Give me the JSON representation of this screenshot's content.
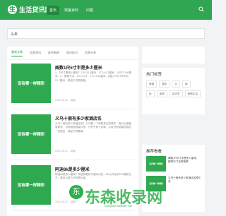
{
  "site": {
    "name": "生活贷讯网",
    "logo_glyph": "生"
  },
  "nav": {
    "items": [
      "首页",
      "常备百科",
      "问答"
    ]
  },
  "breadcrumb": {
    "text": "头条"
  },
  "tabs": [
    "最新文章",
    "信息资讯",
    "综合新闻",
    "知识技巧",
    "信息分享"
  ],
  "posts": [
    {
      "thumb_text": "没有哪一样精彩",
      "title": "阐数1尺5寸半是多少厘米",
      "excerpt": "1、尺5寸是多少厘米？1尺=33.3厘米，5寸=16.7厘米，1尺5寸≈50厘米。2、换算方法：1尺=10寸，1寸=3.33厘米，因此1尺5寸半约为51.7厘米，常用于衣物测量。",
      "meta": [
        "2022-06-21",
        "阅读"
      ]
    },
    {
      "thumb_text": "没有哪一样精彩",
      "title": "义乌十宿有多少家酒店名",
      "excerpt": "义乌十宿有多少家酒店名？义乌是一个商贸发达的城市，吸引大量客商前来，当地酒店数量众多，分布于各个区域，从经济型到高档酒店一应俱全，满足不同需求。",
      "meta": [
        "2022-06-21",
        "阅读"
      ]
    },
    {
      "thumb_text": "没有哪一样精彩",
      "title": "阿迪8k是多少厘米",
      "excerpt": "阿迪8k是多少厘米？阿迪的鞋码与厘米对应，8k大约对应25.5厘米左右，具体以官方尺码表为准。",
      "meta": [
        "2022-06-21",
        "阅读"
      ]
    }
  ],
  "sidebar": {
    "hot_tags_title": "热门标签",
    "tags": [
      "美国",
      "童年",
      "白",
      "城",
      "佳",
      "英语",
      "技巧学",
      "食物生活"
    ],
    "rec_title": "推荐看看",
    "recs": [
      {
        "thumb_text": "没有哪一样精彩",
        "title": "阐数1尺5寸半是多少厘米，脚掌尺寸怎样换算"
      },
      {
        "thumb_text": "没有哪一样精彩",
        "title": "义乌十宿有多少家酒店名称汇总"
      }
    ]
  },
  "watermark": {
    "text": "东森收录网",
    "sub": "Dongsen Website List"
  },
  "colors": {
    "brand": "#31a652"
  }
}
